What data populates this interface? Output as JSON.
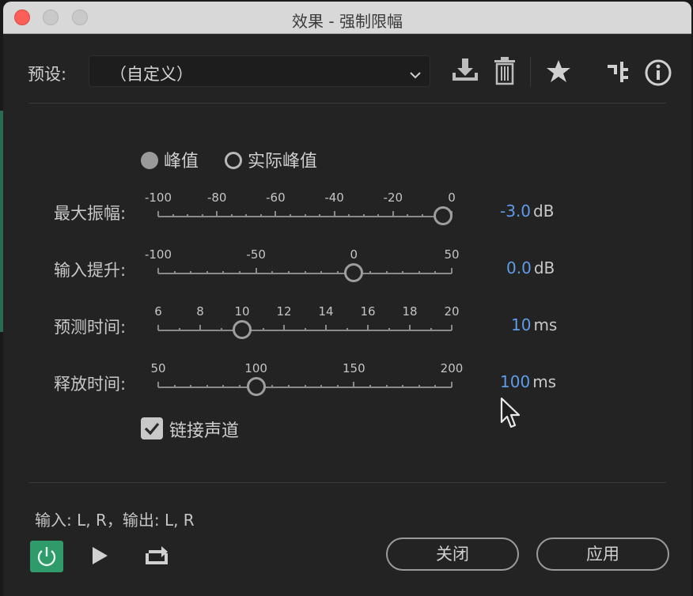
{
  "window": {
    "title": "效果 - 强制限幅"
  },
  "preset": {
    "label": "预设:",
    "value": "（自定义）"
  },
  "mode": {
    "options": [
      {
        "label": "峰值",
        "selected": true
      },
      {
        "label": "实际峰值",
        "selected": false
      }
    ]
  },
  "sliders": [
    {
      "label": "最大振幅:",
      "ticks": [
        "-100",
        "-80",
        "-60",
        "-40",
        "-20",
        "0"
      ],
      "min": -100,
      "max": 0,
      "value": -3.0,
      "value_text": "-3.0",
      "unit": "dB"
    },
    {
      "label": "输入提升:",
      "ticks": [
        "-100",
        "-50",
        "0",
        "50"
      ],
      "min": -100,
      "max": 50,
      "value": 0.0,
      "value_text": "0.0",
      "unit": "dB"
    },
    {
      "label": "预测时间:",
      "ticks": [
        "6",
        "8",
        "10",
        "12",
        "14",
        "16",
        "18",
        "20"
      ],
      "min": 5,
      "max": 20,
      "value": 10,
      "value_text": "10",
      "unit": "ms"
    },
    {
      "label": "释放时间:",
      "ticks": [
        "50",
        "100",
        "150",
        "200"
      ],
      "min": 20,
      "max": 200,
      "value": 100,
      "value_text": "100",
      "unit": "ms"
    }
  ],
  "link_channels": {
    "label": "链接声道",
    "checked": true
  },
  "io": {
    "text": "输入: L, R，输出: L, R"
  },
  "buttons": {
    "close": "关闭",
    "apply": "应用"
  },
  "colors": {
    "accent_value": "#5d9ce6",
    "power_on": "#2f9a6a",
    "close_light": "#fb5f57"
  }
}
